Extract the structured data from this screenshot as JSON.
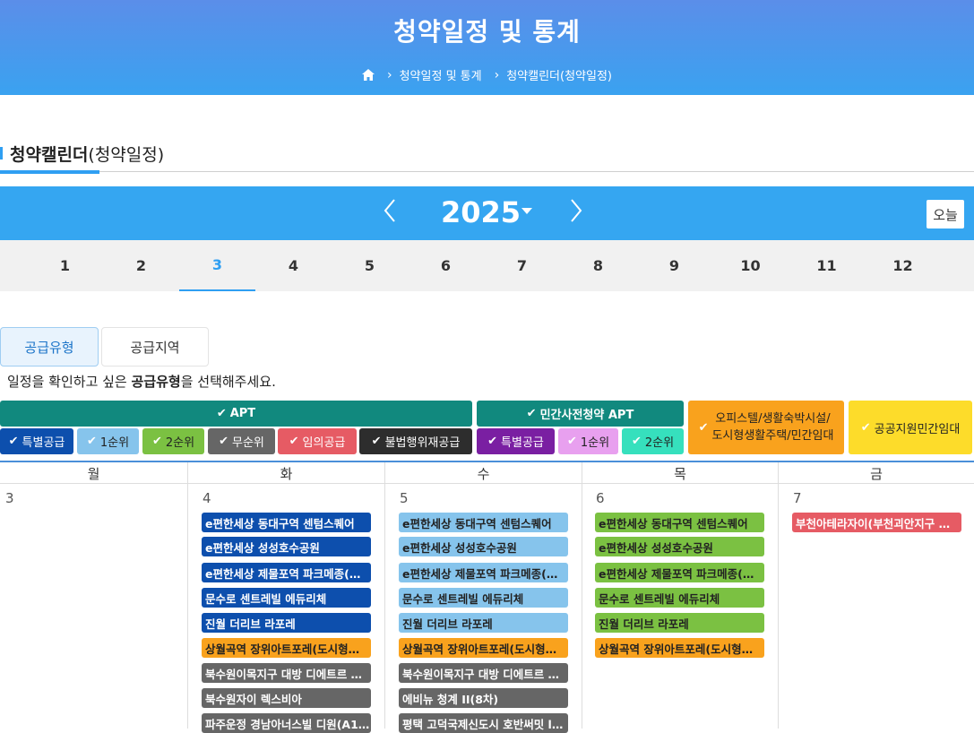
{
  "header": {
    "title": "청약일정 및 통계",
    "breadcrumb": [
      "청약일정 및 통계",
      "청약캘린더(청약일정)"
    ]
  },
  "page_title": {
    "bold": "청약캘린더",
    "rest": "(청약일정)"
  },
  "calendar": {
    "year": "2025",
    "today_label": "오늘",
    "prev_label": "〈",
    "next_label": "〉",
    "months": [
      "1",
      "2",
      "3",
      "4",
      "5",
      "6",
      "7",
      "8",
      "9",
      "10",
      "11",
      "12"
    ],
    "active_month": "3"
  },
  "filter_tabs": [
    "공급유형",
    "공급지역"
  ],
  "guide": {
    "pre": "일정을 확인하고 싶은 ",
    "bold": "공급유형",
    "post": "을 선택해주세요."
  },
  "categories": {
    "apt": "APT",
    "presale": "민간사전청약 APT",
    "officetel": "오피스텔/생활숙박시설/\n도시형생활주택/민간임대",
    "public": "공공지원민간임대"
  },
  "chips": [
    "특별공급",
    "1순위",
    "2순위",
    "무순위",
    "임의공급",
    "불법행위재공급",
    "특별공급",
    "1순위",
    "2순위"
  ],
  "check": "✔",
  "weekdays": [
    "월",
    "화",
    "수",
    "목",
    "금"
  ],
  "dates": [
    "3",
    "4",
    "5",
    "6",
    "7"
  ],
  "events": {
    "tue": [
      "e편한세상 동대구역 센텀스퀘어",
      "e편한세상 성성호수공원",
      "e편한세상 제물포역 파크메종(…",
      "문수로 센트레빌 에듀리체",
      "진월 더리브 라포레",
      "상월곡역 장위아트포레(도시형…",
      "북수원이목지구 대방 디에트르 …",
      "북수원자이 렉스비아",
      "파주운정 경남아너스빌 디원(A1…"
    ],
    "wed": [
      "e편한세상 동대구역 센텀스퀘어",
      "e편한세상 성성호수공원",
      "e편한세상 제물포역 파크메종(…",
      "문수로 센트레빌 에듀리체",
      "진월 더리브 라포레",
      "상월곡역 장위아트포레(도시형…",
      "북수원이목지구 대방 디에트르 …",
      "에비뉴 청계 II(8차)",
      "평택 고덕국제신도시 호반써밋 l…"
    ],
    "thu": [
      "e편한세상 동대구역 센텀스퀘어",
      "e편한세상 성성호수공원",
      "e편한세상 제물포역 파크메종(…",
      "문수로 센트레빌 에듀리체",
      "진월 더리브 라포레",
      "상월곡역 장위아트포레(도시형…"
    ],
    "fri": [
      "부천아테라자이(부천괴안지구 …"
    ]
  },
  "colors": {
    "special": "#0d4fad",
    "first": "#86c4ec",
    "second": "#7bc142",
    "none": "#666666",
    "arbitrary": "#e65b64",
    "illegal": "#2d2d2d",
    "presale_special": "#7a1fa2",
    "presale_first": "#e8a0ef",
    "presale_second": "#36e0bd",
    "officetel": "#f9a21d",
    "public": "#fddc2a",
    "apt": "#11897e"
  }
}
